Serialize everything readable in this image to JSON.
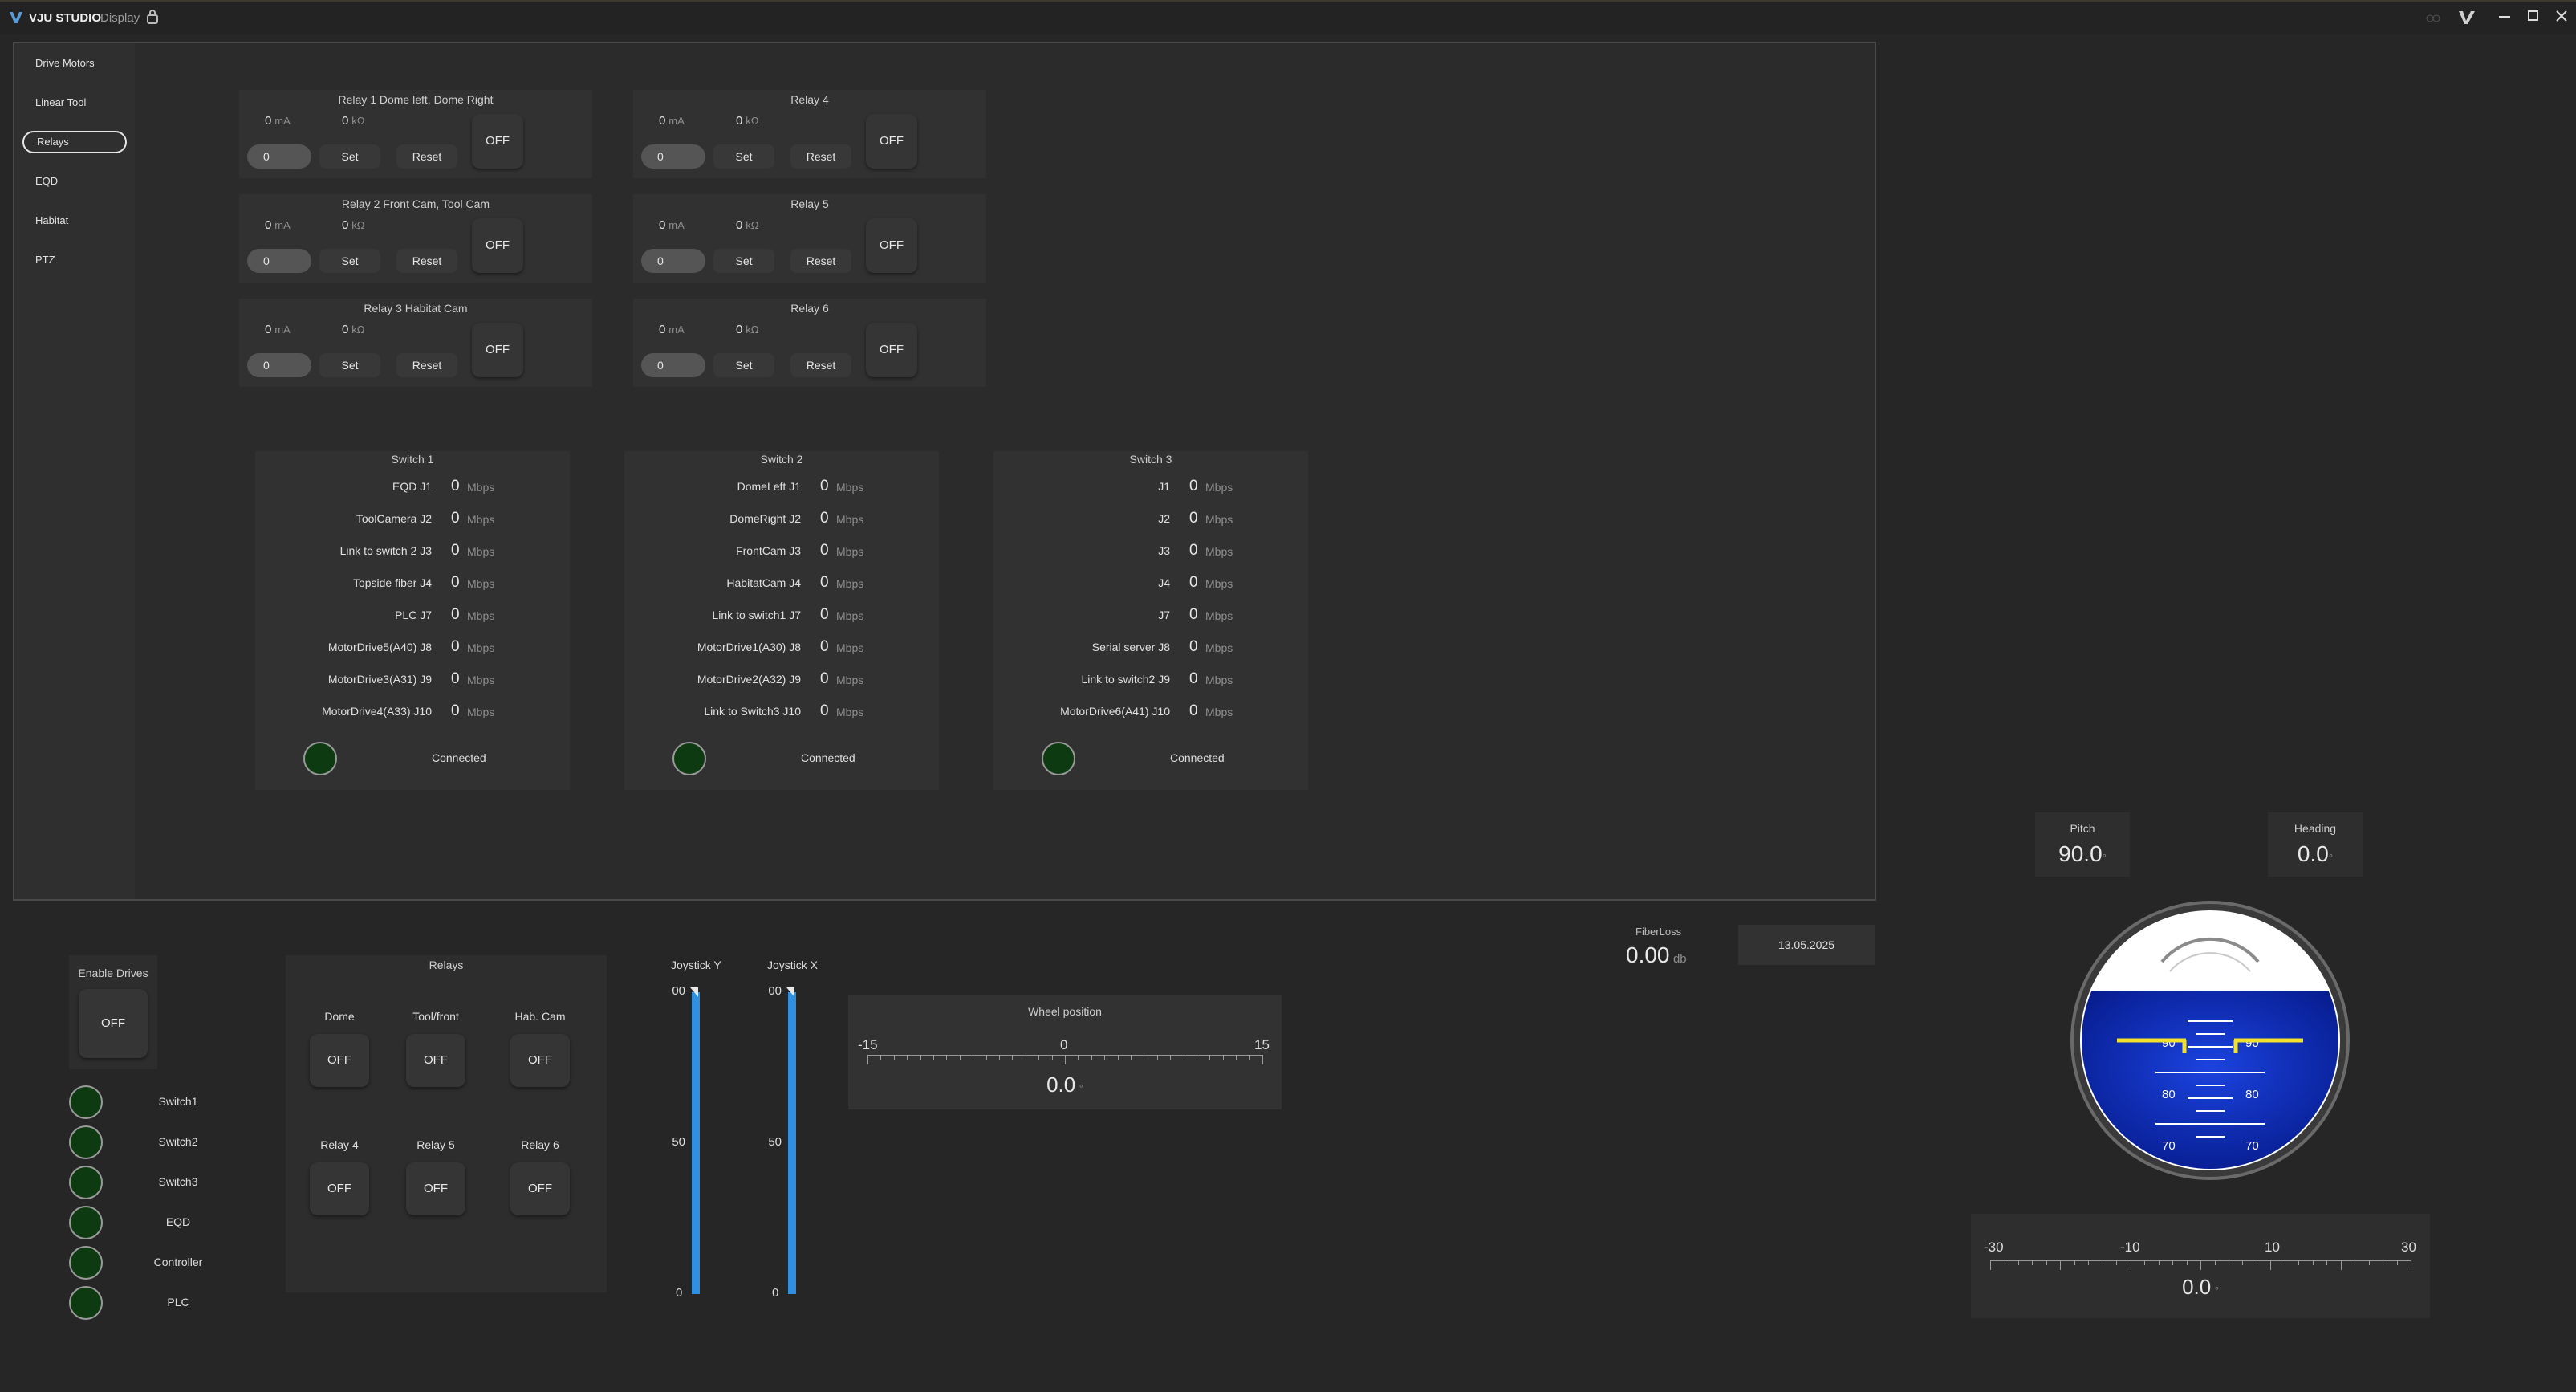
{
  "window": {
    "app_name": "VJU STUDIO",
    "app_subtitle": "Display"
  },
  "sidebar": {
    "items": [
      {
        "label": "Drive Motors"
      },
      {
        "label": "Linear Tool"
      },
      {
        "label": "Relays"
      },
      {
        "label": "EQD"
      },
      {
        "label": "Habitat"
      },
      {
        "label": "PTZ"
      }
    ]
  },
  "relay_panels": [
    {
      "title": "Relay 1 Dome left, Dome Right",
      "current": "0",
      "current_unit": "mA",
      "resistance": "0",
      "resistance_unit": "kΩ",
      "input": "0",
      "set": "Set",
      "reset": "Reset",
      "state": "OFF"
    },
    {
      "title": "Relay 4",
      "current": "0",
      "current_unit": "mA",
      "resistance": "0",
      "resistance_unit": "kΩ",
      "input": "0",
      "set": "Set",
      "reset": "Reset",
      "state": "OFF"
    },
    {
      "title": "Relay 2 Front Cam, Tool Cam",
      "current": "0",
      "current_unit": "mA",
      "resistance": "0",
      "resistance_unit": "kΩ",
      "input": "0",
      "set": "Set",
      "reset": "Reset",
      "state": "OFF"
    },
    {
      "title": "Relay 5",
      "current": "0",
      "current_unit": "mA",
      "resistance": "0",
      "resistance_unit": "kΩ",
      "input": "0",
      "set": "Set",
      "reset": "Reset",
      "state": "OFF"
    },
    {
      "title": "Relay 3 Habitat Cam",
      "current": "0",
      "current_unit": "mA",
      "resistance": "0",
      "resistance_unit": "kΩ",
      "input": "0",
      "set": "Set",
      "reset": "Reset",
      "state": "OFF"
    },
    {
      "title": "Relay 6",
      "current": "0",
      "current_unit": "mA",
      "resistance": "0",
      "resistance_unit": "kΩ",
      "input": "0",
      "set": "Set",
      "reset": "Reset",
      "state": "OFF"
    }
  ],
  "switches": [
    {
      "title": "Switch 1",
      "status": "Connected",
      "ports": [
        {
          "name": "EQD J1",
          "value": "0",
          "unit": "Mbps"
        },
        {
          "name": "ToolCamera J2",
          "value": "0",
          "unit": "Mbps"
        },
        {
          "name": "Link to switch 2 J3",
          "value": "0",
          "unit": "Mbps"
        },
        {
          "name": "Topside fiber J4",
          "value": "0",
          "unit": "Mbps"
        },
        {
          "name": "PLC J7",
          "value": "0",
          "unit": "Mbps"
        },
        {
          "name": "MotorDrive5(A40) J8",
          "value": "0",
          "unit": "Mbps"
        },
        {
          "name": "MotorDrive3(A31) J9",
          "value": "0",
          "unit": "Mbps"
        },
        {
          "name": "MotorDrive4(A33) J10",
          "value": "0",
          "unit": "Mbps"
        }
      ]
    },
    {
      "title": "Switch 2",
      "status": "Connected",
      "ports": [
        {
          "name": "DomeLeft J1",
          "value": "0",
          "unit": "Mbps"
        },
        {
          "name": "DomeRight J2",
          "value": "0",
          "unit": "Mbps"
        },
        {
          "name": "FrontCam J3",
          "value": "0",
          "unit": "Mbps"
        },
        {
          "name": "HabitatCam J4",
          "value": "0",
          "unit": "Mbps"
        },
        {
          "name": "Link to switch1 J7",
          "value": "0",
          "unit": "Mbps"
        },
        {
          "name": "MotorDrive1(A30) J8",
          "value": "0",
          "unit": "Mbps"
        },
        {
          "name": "MotorDrive2(A32) J9",
          "value": "0",
          "unit": "Mbps"
        },
        {
          "name": "Link to Switch3 J10",
          "value": "0",
          "unit": "Mbps"
        }
      ]
    },
    {
      "title": "Switch 3",
      "status": "Connected",
      "ports": [
        {
          "name": "J1",
          "value": "0",
          "unit": "Mbps"
        },
        {
          "name": "J2",
          "value": "0",
          "unit": "Mbps"
        },
        {
          "name": "J3",
          "value": "0",
          "unit": "Mbps"
        },
        {
          "name": "J4",
          "value": "0",
          "unit": "Mbps"
        },
        {
          "name": "J7",
          "value": "0",
          "unit": "Mbps"
        },
        {
          "name": "Serial server J8",
          "value": "0",
          "unit": "Mbps"
        },
        {
          "name": "Link to switch2 J9",
          "value": "0",
          "unit": "Mbps"
        },
        {
          "name": "MotorDrive6(A41) J10",
          "value": "0",
          "unit": "Mbps"
        }
      ]
    }
  ],
  "enable_drives": {
    "title": "Enable Drives",
    "state": "OFF"
  },
  "status_leds": [
    {
      "label": "Switch1"
    },
    {
      "label": "Switch2"
    },
    {
      "label": "Switch3"
    },
    {
      "label": "EQD"
    },
    {
      "label": "Controller"
    },
    {
      "label": "PLC"
    }
  ],
  "relays_quick": {
    "title": "Relays",
    "items": [
      {
        "label": "Dome",
        "state": "OFF"
      },
      {
        "label": "Tool/front",
        "state": "OFF"
      },
      {
        "label": "Hab. Cam",
        "state": "OFF"
      },
      {
        "label": "Relay 4",
        "state": "OFF"
      },
      {
        "label": "Relay 5",
        "state": "OFF"
      },
      {
        "label": "Relay 6",
        "state": "OFF"
      }
    ]
  },
  "joysticks": [
    {
      "label": "Joystick Y",
      "top_label": "00",
      "mid_label": "50",
      "bottom_label": "0",
      "level": 1.0
    },
    {
      "label": "Joystick X",
      "top_label": "00",
      "mid_label": "50",
      "bottom_label": "0",
      "level": 1.0
    }
  ],
  "wheel_position": {
    "title": "Wheel position",
    "scale_min": "-15",
    "scale_mid": "0",
    "scale_max": "15",
    "value": "0.0",
    "unit": "°"
  },
  "fiber_loss": {
    "label": "FiberLoss",
    "value": "0.00",
    "unit": "db"
  },
  "date": "13.05.2025",
  "pitch": {
    "label": "Pitch",
    "value": "90.0",
    "unit": "°"
  },
  "heading": {
    "label": "Heading",
    "value": "0.0",
    "unit": "°"
  },
  "attitude": {
    "labels_left": [
      "90",
      "80",
      "70"
    ],
    "labels_right": [
      "90",
      "80",
      "70"
    ]
  },
  "roll_scale": {
    "ticks": [
      "-30",
      "-10",
      "10",
      "30"
    ],
    "value": "0.0",
    "unit": "°"
  },
  "colors": {
    "led_green": "#0e3a12",
    "slider_blue": "#2f8fe0",
    "horizon_blue": "#0a2bbf",
    "horizon_yellow": "#f2e22a"
  }
}
